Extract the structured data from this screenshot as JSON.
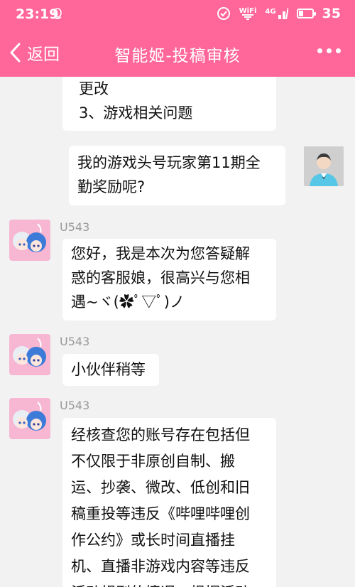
{
  "status_bar": {
    "time": "23:19",
    "wifi_label": "WiFi",
    "network_label": "4G",
    "battery_level": 35,
    "battery_text": "35",
    "icons": [
      "qq-icon",
      "sync-icon",
      "wifi-icon",
      "signal-icon",
      "battery-icon"
    ]
  },
  "header": {
    "back_label": "返回",
    "title": "智能姬-投稿审核",
    "more_icon": "more-dots-icon",
    "bg_color": "#ff6699"
  },
  "messages": [
    {
      "side": "left",
      "lines": [
        "更改",
        "3、游戏相关问题"
      ]
    },
    {
      "side": "right",
      "lines": [
        "我的游戏头号玩家第11期全",
        "勤奖励呢?"
      ]
    },
    {
      "side": "left",
      "sender": "U543",
      "lines": [
        "您好，我是本次为您答疑解",
        "惑的客服娘，很高兴与您相",
        "遇~ヾ(✿ﾟ▽ﾟ)ノ"
      ]
    },
    {
      "side": "left",
      "sender": "U543",
      "lines": [
        "小伙伴稍等"
      ]
    },
    {
      "side": "left",
      "sender": "U543",
      "lines": [
        "经核查您的账号存在包括但",
        "不仅限于非原创自制、搬",
        "运、抄袭、微改、低创和旧",
        "稿重投等违反《哔哩哔哩创",
        "作公约》或长时间直播挂",
        "机、直播非游戏内容等违反",
        "活动规则的情况，根据活动"
      ]
    }
  ]
}
